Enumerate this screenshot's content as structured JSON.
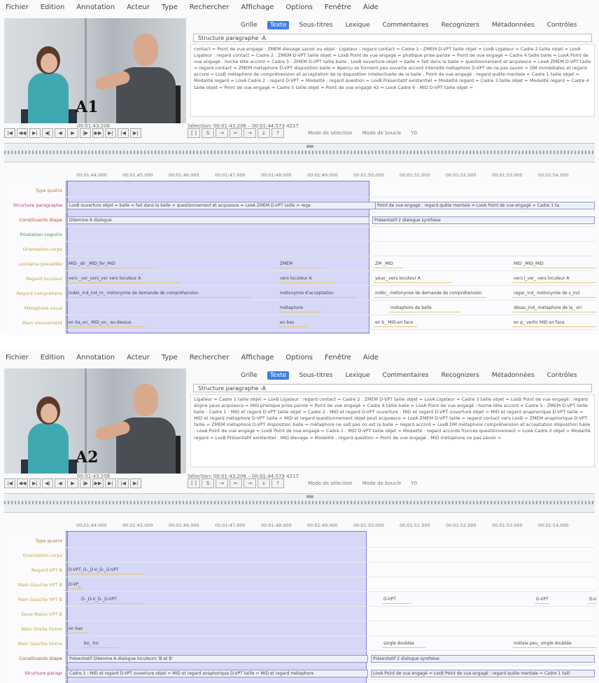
{
  "menu": [
    "Fichier",
    "Edition",
    "Annotation",
    "Acteur",
    "Type",
    "Rechercher",
    "Affichage",
    "Options",
    "Fenêtre",
    "Aide"
  ],
  "tabs": [
    "Grille",
    "Texte",
    "Sous-titres",
    "Lexique",
    "Commentaires",
    "Recognizers",
    "Métadonnées",
    "Contrôles"
  ],
  "active_tab": "Texte",
  "panels": [
    {
      "label": "A1",
      "tier_select": "Structure paragraphe -A",
      "transcript": "contact = Point de vue engagé : ZMEM élevage savoir ou objet · Ligateur : regard contact = Cadre 1 : ZMEM D-VPT taille objet = LoxB Ligateur = Cadre 2 taille objet = LoxA Ligateur : regard contact = Cadre 2 : ZMEM D-VPT taille objet = LoxB Point de vue engagé = phatique prise parole = Point de vue engagé = Cadre 4 taille balle = LoxA Point de vue engagé : hoche tête accord = Cadre 5 : ZMEM D-VPT taille balle : LoxB ouverture objet = balle = fait dans la balle = questionnement et acquiesce = LoxA ZMEM D-VPT taille = regard contact = ZMEM métaphore D-VPT disposition balle = Aperçu se forment peu ouverte accord intensité métaphore D-VPT de ne pas savoir = DM immédiates et regard accord = LoxB métaphore de compréhension et acceptation de la disposition intellectuelle de la balle : Point de vue engagé : regard quête mentale = Cadre 1 taille objet = Modalité regard = LoxA Cadre 2 : regard D-VPT = Modalité : regard question = LoxB Présentatif existentiel = Modalité regard = Cadre 3 taille objet = Modalité regard = Cadre 4 taille objet = Point de vue engagé = Cadre 5 taille objet = Point de vue engagé 42 = LoxA Cadre 6 : MID D-VPT taille objet =",
      "timecode": "00:01:43.206",
      "selection": "Sélection: 00:01:43.206 – 00:01:44.573  4217",
      "modes": [
        "Mode de sélection",
        "Mode de boucle",
        "Y0"
      ],
      "ruler": [
        "00:01:44.000",
        "00:01:45.000",
        "00:01:46.000",
        "00:01:47.000",
        "00:01:48.000",
        "00:01:49.000",
        "00:01:50.000",
        "00:01:51.000",
        "00:01:52.000",
        "00:01:53.000",
        "00:01:54.000"
      ],
      "tiers": [
        {
          "name": "Type quatre",
          "color": "#b07a2a"
        },
        {
          "name": "Structure paragraphe",
          "color": "#b03a6a"
        },
        {
          "name": "Constituants étape",
          "color": "#c0462c"
        },
        {
          "name": "Prostation cognitiv",
          "color": "#3a9a3a"
        },
        {
          "name": "Orientation corps",
          "color": "#c0a040"
        },
        {
          "name": "Lointaine possédée",
          "color": "#c0a040"
        },
        {
          "name": "Regard locuteur",
          "color": "#c0a040"
        },
        {
          "name": "Regard compréhens",
          "color": "#c0a040"
        },
        {
          "name": "Métaphore vocal",
          "color": "#c0a040"
        },
        {
          "name": "Main mouvement",
          "color": "#c0a040"
        }
      ],
      "annotations": [
        {
          "tier": 1,
          "text": "LoxB ouverture objet = balle = fait dans la balle = questionnement et acquiesce = LoxA ZMEM D-VPT taille = rega",
          "style": "box"
        },
        {
          "tier": 1,
          "text": "Point de vue engagé : regard quête mentale = LoxA Point de vue engagé = Cadre 1 ta",
          "style": "box"
        },
        {
          "tier": 2,
          "text": "Dilemme A dialogue",
          "style": "box"
        },
        {
          "tier": 2,
          "text": "Présentatif 2 dialogue synthèse",
          "style": "box"
        },
        {
          "tier": 5,
          "text": "MID  _dir _MID_fer_MID",
          "style": "plain"
        },
        {
          "tier": 5,
          "text": "ZMEM",
          "style": "plain"
        },
        {
          "tier": 5,
          "text": "ZM _MID",
          "style": "plain"
        },
        {
          "tier": 5,
          "text": "MID _MID_MID",
          "style": "plain"
        },
        {
          "tier": 6,
          "text": "vers _ver_vers_ver vers locuteur A",
          "style": "plain"
        },
        {
          "tier": 6,
          "text": "vers locuteur A",
          "style": "plain"
        },
        {
          "tier": 6,
          "text": "yeux_ vers locuteur A",
          "style": "plain"
        },
        {
          "tier": 6,
          "text": "vers l_ver_ vers locuteur A",
          "style": "plain"
        },
        {
          "tier": 7,
          "text": "indéc_ind_ind_m_ métonymie de demande de compréhension",
          "style": "plain"
        },
        {
          "tier": 7,
          "text": "métonymie d'acceptation",
          "style": "plain"
        },
        {
          "tier": 7,
          "text": "indéc_ métonymie de demande de compréhension",
          "style": "plain"
        },
        {
          "tier": 7,
          "text": "regar_ind_ métonymie de s_ind",
          "style": "plain"
        },
        {
          "tier": 8,
          "text": "métaphore",
          "style": "plain"
        },
        {
          "tier": 8,
          "text": "métaphore de balle",
          "style": "plain"
        },
        {
          "tier": 8,
          "text": "désac_ind_ métaphore de la_ ori",
          "style": "plain"
        },
        {
          "tier": 9,
          "text": "en ba_en_ MID_en_ au-dessus",
          "style": "plain"
        },
        {
          "tier": 9,
          "text": "en bas",
          "style": "plain"
        },
        {
          "tier": 9,
          "text": "en b_ MID-en face",
          "style": "plain"
        },
        {
          "tier": 9,
          "text": "en p_ vertic MID en face",
          "style": "plain"
        }
      ]
    },
    {
      "label": "A2",
      "tier_select": "Structure paragraphe -A",
      "transcript": "Ligateur = Cadre 1 taille objet = LoxB Ligateur : regard contact = Cadre 2 : ZMEM D-VPT taille objet = LoxA Ligateur = Cadre 3 taille objet = LoxB Point de vue engagé : regard éligne yeux acquiesce = MID phatique prise parole = Point de vue engagé = Cadre 4 taille balle = LoxA Point de vue engagé : hoche tête accord = Cadre 5 : ZMEM D-VPT taille balle : Cadre 1 : MID et regard D-VPT taille objet = Cadre 2 : MID et regard D-VPT ouverture : MID et regard D-VPT ouverture objet = MID et regard anaphorique D-VPT taille = MID et regard métaphore D-VPT taille = MID et regard questionnement objet peut acquiesce = LoxA ZMEM D-VPT taille = regard contact vers LoxB = ZMEM anaphorique D-VPT taille = ZMEM métaphore D-VPT disposition balle = métaphore ne sait pas où est la balle = regard accord = LoxB DM métaphore compréhension et acceptation disposition balle : LoxA Point de vue engagé = LoxB Point de vue engagé = Cadre 1 : MID D-VPT taille objet = Modalité : regard accords fronces questionnement = LoxA Cadre 2 objet = Modalité regard = LoxB Présentatif existentiel : MID élevage = Modalité : regard question = Point de vue engagé : MID métaphore ne pas savoir =",
      "timecode": "00:01:43.206",
      "selection": "Sélection: 00:01:43.206 – 00:01:44.573  4217",
      "modes": [
        "Mode de sélection",
        "Mode de boucle",
        "Y0"
      ],
      "ruler": [
        "00:01:44.000",
        "00:01:45.000",
        "00:01:46.000",
        "00:01:47.000",
        "00:01:48.000",
        "00:01:49.000",
        "00:01:50.000",
        "00:01:51.000",
        "00:01:52.000",
        "00:01:53.000",
        "00:01:54.000"
      ],
      "tiers": [
        {
          "name": "Type quatre",
          "color": "#b07a2a"
        },
        {
          "name": "Orientation corps",
          "color": "#c0a040"
        },
        {
          "name": "Regard VPT B",
          "color": "#c0a040"
        },
        {
          "name": "Main Gauche VPT B",
          "color": "#c0a040"
        },
        {
          "name": "Main Gauche VPT B",
          "color": "#c0a040"
        },
        {
          "name": "Deux Mains VPT B",
          "color": "#c0a040"
        },
        {
          "name": "Main Droite forme",
          "color": "#c0a040"
        },
        {
          "name": "Main Gauche forme",
          "color": "#c0a040"
        },
        {
          "name": "Constituants étape",
          "color": "#c0462c"
        },
        {
          "name": "Structure paragr",
          "color": "#b03a6a"
        }
      ],
      "annotations": [
        {
          "tier": 2,
          "text": "D-VPT_D-_D-V_D-_D-VPT",
          "style": "plain"
        },
        {
          "tier": 3,
          "text": "D-VP_",
          "style": "plain"
        },
        {
          "tier": 4,
          "text": "D-_D-V_D-_D-VPT",
          "style": "plain"
        },
        {
          "tier": 4,
          "text": "D-VPT",
          "style": "plain"
        },
        {
          "tier": 4,
          "text": "D-VPT",
          "style": "plain"
        },
        {
          "tier": 4,
          "text": "D-V",
          "style": "plain"
        },
        {
          "tier": 6,
          "text": "en bas",
          "style": "plain"
        },
        {
          "tier": 7,
          "text": "bo_      tro",
          "style": "plain"
        },
        {
          "tier": 7,
          "text": "single doublée",
          "style": "plain"
        },
        {
          "tier": 7,
          "text": "métaie peu_ single doublée",
          "style": "plain"
        },
        {
          "tier": 8,
          "text": "Présentatif Dilemme A dialogue locuteurs 'B et B'",
          "style": "box"
        },
        {
          "tier": 8,
          "text": "Présentatif 2 dialogue synthèse",
          "style": "box"
        },
        {
          "tier": 9,
          "text": "Cadre 1 : MID et regard D-VPT ouverture objet = MID et regard anaphorique D-VPT taille = MID et regard métaphore",
          "style": "box"
        },
        {
          "tier": 9,
          "text": "LoxA Point de vue engagé = LoxB Point de vue engagé : regard quête mentale = Cadre 1 taill",
          "style": "box"
        }
      ]
    }
  ]
}
